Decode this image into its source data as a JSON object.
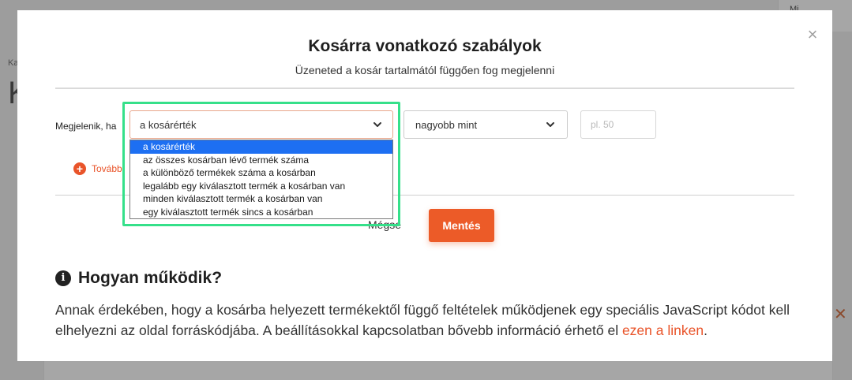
{
  "background": {
    "top_right_label": "Mi",
    "left_small_label": "Ka",
    "left_big_label": "K",
    "right_close": "✕"
  },
  "modal": {
    "title": "Kosárra vonatkozó szabályok",
    "subtitle": "Üzeneted a kosár tartalmától függően fog megjelenni",
    "close_label": "×",
    "row_label": "Megjelenik, ha",
    "condition_select": {
      "value": "a kosárérték",
      "options": [
        "a kosárérték",
        "az összes kosárban lévő termék száma",
        "a különböző termékek száma a kosárban",
        "legalább egy kiválasztott termék a kosárban van",
        "minden kiválasztott termék a kosárban van",
        "egy kiválasztott termék sincs a kosárban"
      ],
      "highlighted_index": 0
    },
    "operator_select": {
      "value": "nagyobb mint"
    },
    "value_input": {
      "placeholder": "pl. 50",
      "value": ""
    },
    "add_rule_label": "További",
    "cancel_label": "Mégse",
    "save_label": "Mentés"
  },
  "how": {
    "title": "Hogyan működik?",
    "text_before_link": "Annak érdekében, hogy a kosárba helyezett termékektől függő feltételek működjenek egy speciális JavaScript kódot kell elhelyezni az oldal forráskódjába. A beállításokkal kapcsolatban bővebb információ érhető el ",
    "link_text": "ezen a linken",
    "text_after_link": "."
  },
  "colors": {
    "accent": "#ec5b28",
    "highlight_frame": "#35e08a",
    "dropdown_selected": "#1d6ff2"
  }
}
